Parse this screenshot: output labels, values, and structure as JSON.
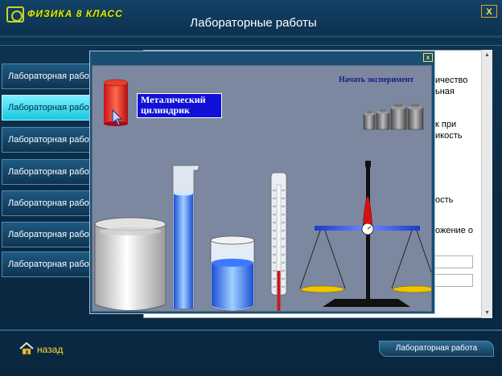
{
  "window": {
    "app_title": "ФИЗИКА 8 КЛАСС",
    "page_title": "Лабораторные работы",
    "close_label": "X"
  },
  "sidebar": {
    "items": [
      {
        "label": "Лабораторная работа",
        "active": false
      },
      {
        "label": "Лабораторная работа",
        "active": true
      },
      {
        "label": "Лабораторная работа",
        "active": false
      },
      {
        "label": "Лабораторная работа",
        "active": false
      },
      {
        "label": "Лабораторная работа",
        "active": false
      },
      {
        "label": "Лабораторная работа",
        "active": false
      },
      {
        "label": "Лабораторная работа",
        "active": false
      }
    ]
  },
  "document": {
    "fragments": [
      "ичество",
      "ьная",
      "к при",
      "икость",
      "ость",
      "ожение о"
    ]
  },
  "experiment": {
    "close_label": "x",
    "start_label": "Начать эксперимент",
    "object_label_line1": "Металический",
    "object_label_line2": "цилиндрик",
    "items": [
      "cylinder",
      "large-beaker",
      "measuring-cylinder",
      "small-beaker",
      "thermometer",
      "balance-scale",
      "weights"
    ]
  },
  "footer": {
    "back_label": "назад",
    "status_label": "Лабораторная работа"
  },
  "colors": {
    "background": "#0b2a44",
    "active_item": "#18c8e2",
    "accent_yellow": "#ffdc3a",
    "canvas": "#7b889f",
    "label_box": "#1010d8"
  }
}
